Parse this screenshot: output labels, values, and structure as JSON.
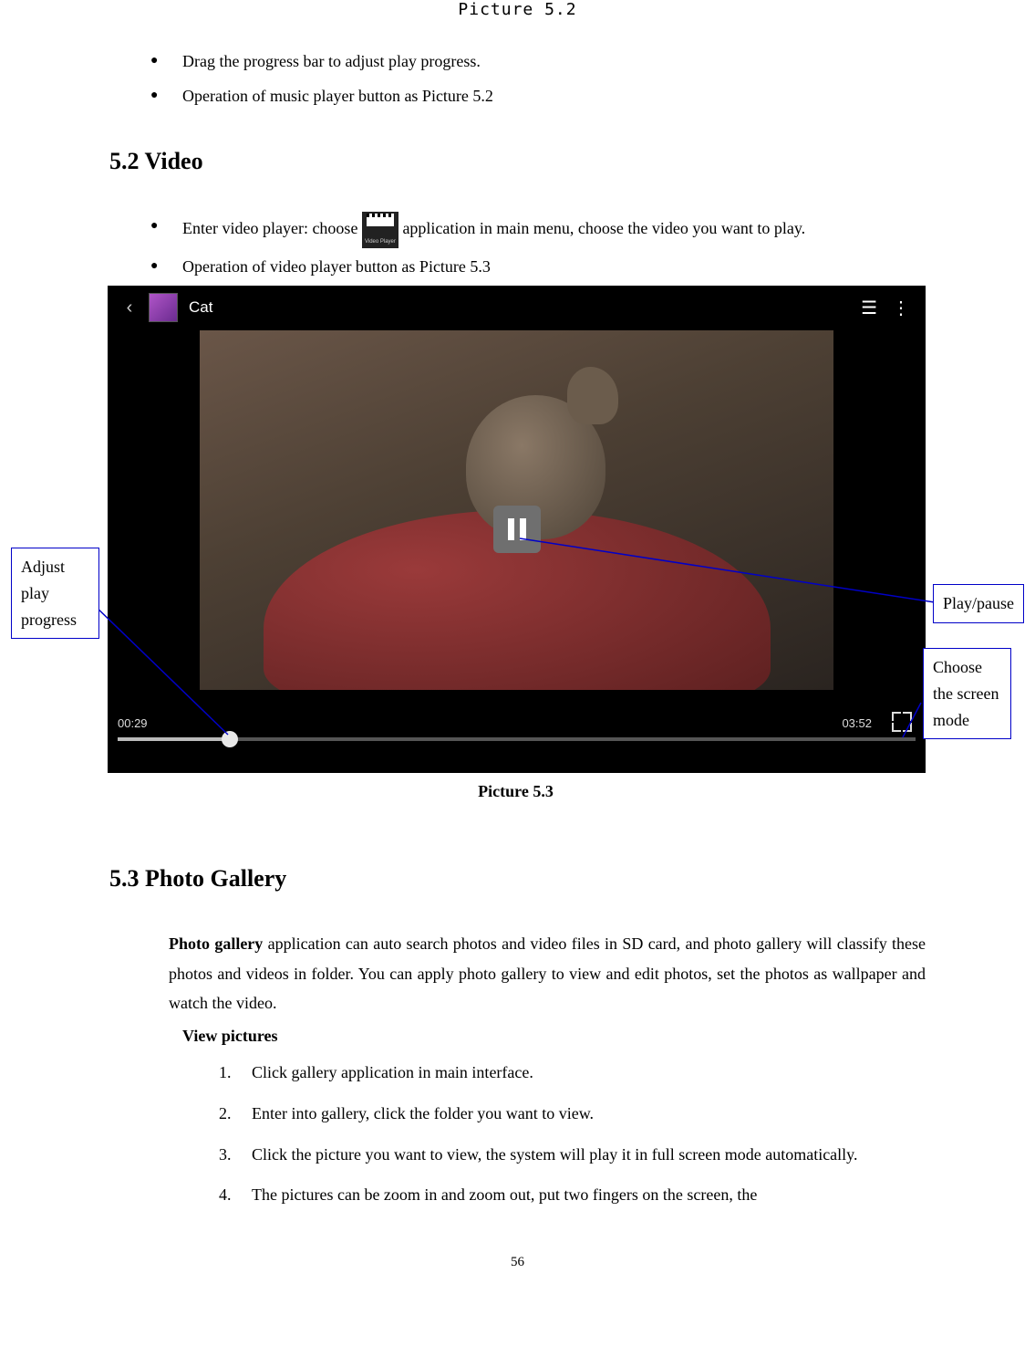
{
  "caption_top": "Picture 5.2",
  "bullets_top": {
    "b1": "Drag the progress bar to adjust play progress.",
    "b2": "Operation of music player button as Picture 5.2"
  },
  "heading_video": "5.2 Video",
  "video_bullets": {
    "b1_pre": "Enter video player: choose ",
    "b1_post": "application in main menu, choose the video you want to play.",
    "b2": "Operation of video player button as Picture 5.3",
    "app_icon_label": "Video Player"
  },
  "video_shot": {
    "title": "Cat",
    "time_left": "00:29",
    "time_right": "03:52"
  },
  "caption_video": "Picture 5.3",
  "callouts": {
    "adjust": "Adjust play progress",
    "play": "Play/pause",
    "screen": "Choose the screen mode"
  },
  "heading_gallery": "5.3 Photo Gallery",
  "gallery_para_bold": "Photo gallery",
  "gallery_para_rest": " application can auto search photos and video files in SD card, and photo gallery will classify these photos and videos in folder. You can apply photo gallery to view and edit photos, set the photos as wallpaper and watch the video.",
  "gallery_subhead": "View pictures",
  "steps": {
    "s1": "Click gallery application in main interface.",
    "s2": "Enter into gallery, click the folder you want to view.",
    "s3": "Click the picture you want to view, the system will play it in full screen mode automatically.",
    "s4": "The pictures can be zoom in and zoom out, put two fingers on the screen, the"
  },
  "page_number": "56"
}
